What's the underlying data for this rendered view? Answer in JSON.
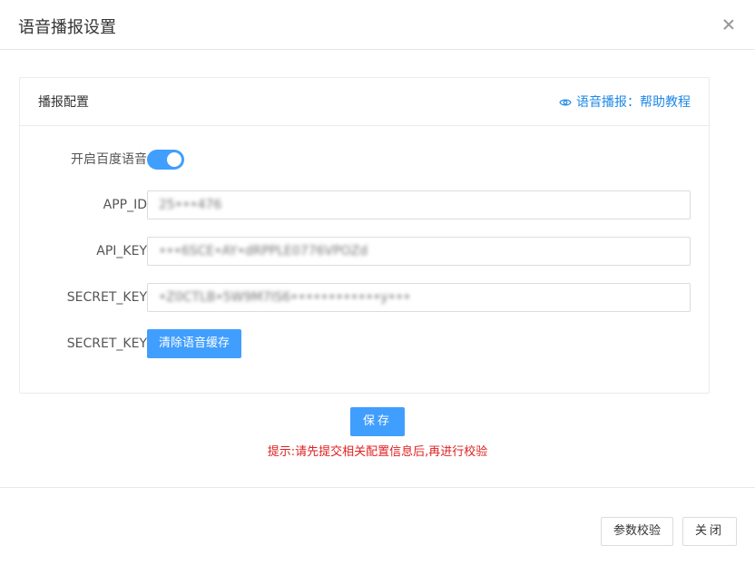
{
  "dialog": {
    "title": "语音播报设置"
  },
  "card": {
    "title": "播报配置",
    "help_link": "语音播报：帮助教程"
  },
  "form": {
    "baidu_voice": {
      "label": "开启百度语音",
      "enabled": true
    },
    "app_id": {
      "label": "APP_ID",
      "value": "25•••476"
    },
    "api_key": {
      "label": "API_KEY",
      "value": "•••6SCE•AY•dRPPLE0776VPOZd"
    },
    "secret_key": {
      "label": "SECRET_KEY",
      "value": "•Z0CTLB•5W9M7IS6••••••••••••y•••"
    },
    "cache": {
      "label": "SECRET_KEY",
      "button_label": "清除语音缓存"
    }
  },
  "actions": {
    "save_label": "保存",
    "tip": "提示:请先提交相关配置信息后,再进行校验"
  },
  "footer": {
    "verify_label": "参数校验",
    "close_label": "关闭"
  },
  "colors": {
    "primary": "#409eff",
    "link": "#1e88e5",
    "warning_text": "#e02020"
  }
}
